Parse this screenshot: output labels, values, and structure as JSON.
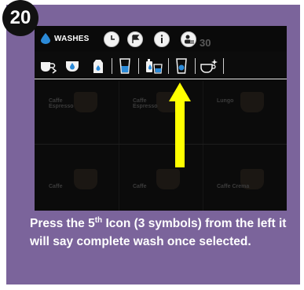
{
  "step": {
    "number": "20"
  },
  "screen": {
    "topbar": {
      "washes_label": "WASHES",
      "counter": "30",
      "icons": [
        "water-drop-icon",
        "clock-icon",
        "flag-icon",
        "info-icon",
        "user-profile-icon"
      ]
    },
    "wash_icons": [
      "cup-rinse-icon",
      "cup-wash-icon",
      "milk-carton-icon",
      "glass-icon",
      "complete-wash-icon",
      "water-glass-icon",
      "cup-sparkle-icon"
    ],
    "tiles": {
      "row1": [
        "Caffe Espresso",
        "Caffe Espresso",
        "Lungo"
      ],
      "row2": [
        "Caffe",
        "Caffe",
        "Caffe Crema"
      ]
    }
  },
  "caption": {
    "part1": "Press the 5",
    "superscript": "th",
    "part2": " Icon (3 symbols) from the left it will say complete wash once selected."
  },
  "colors": {
    "card": "#7b649b",
    "badge": "#111111",
    "arrow": "#ffff00",
    "screen": "#0b0b0b"
  }
}
